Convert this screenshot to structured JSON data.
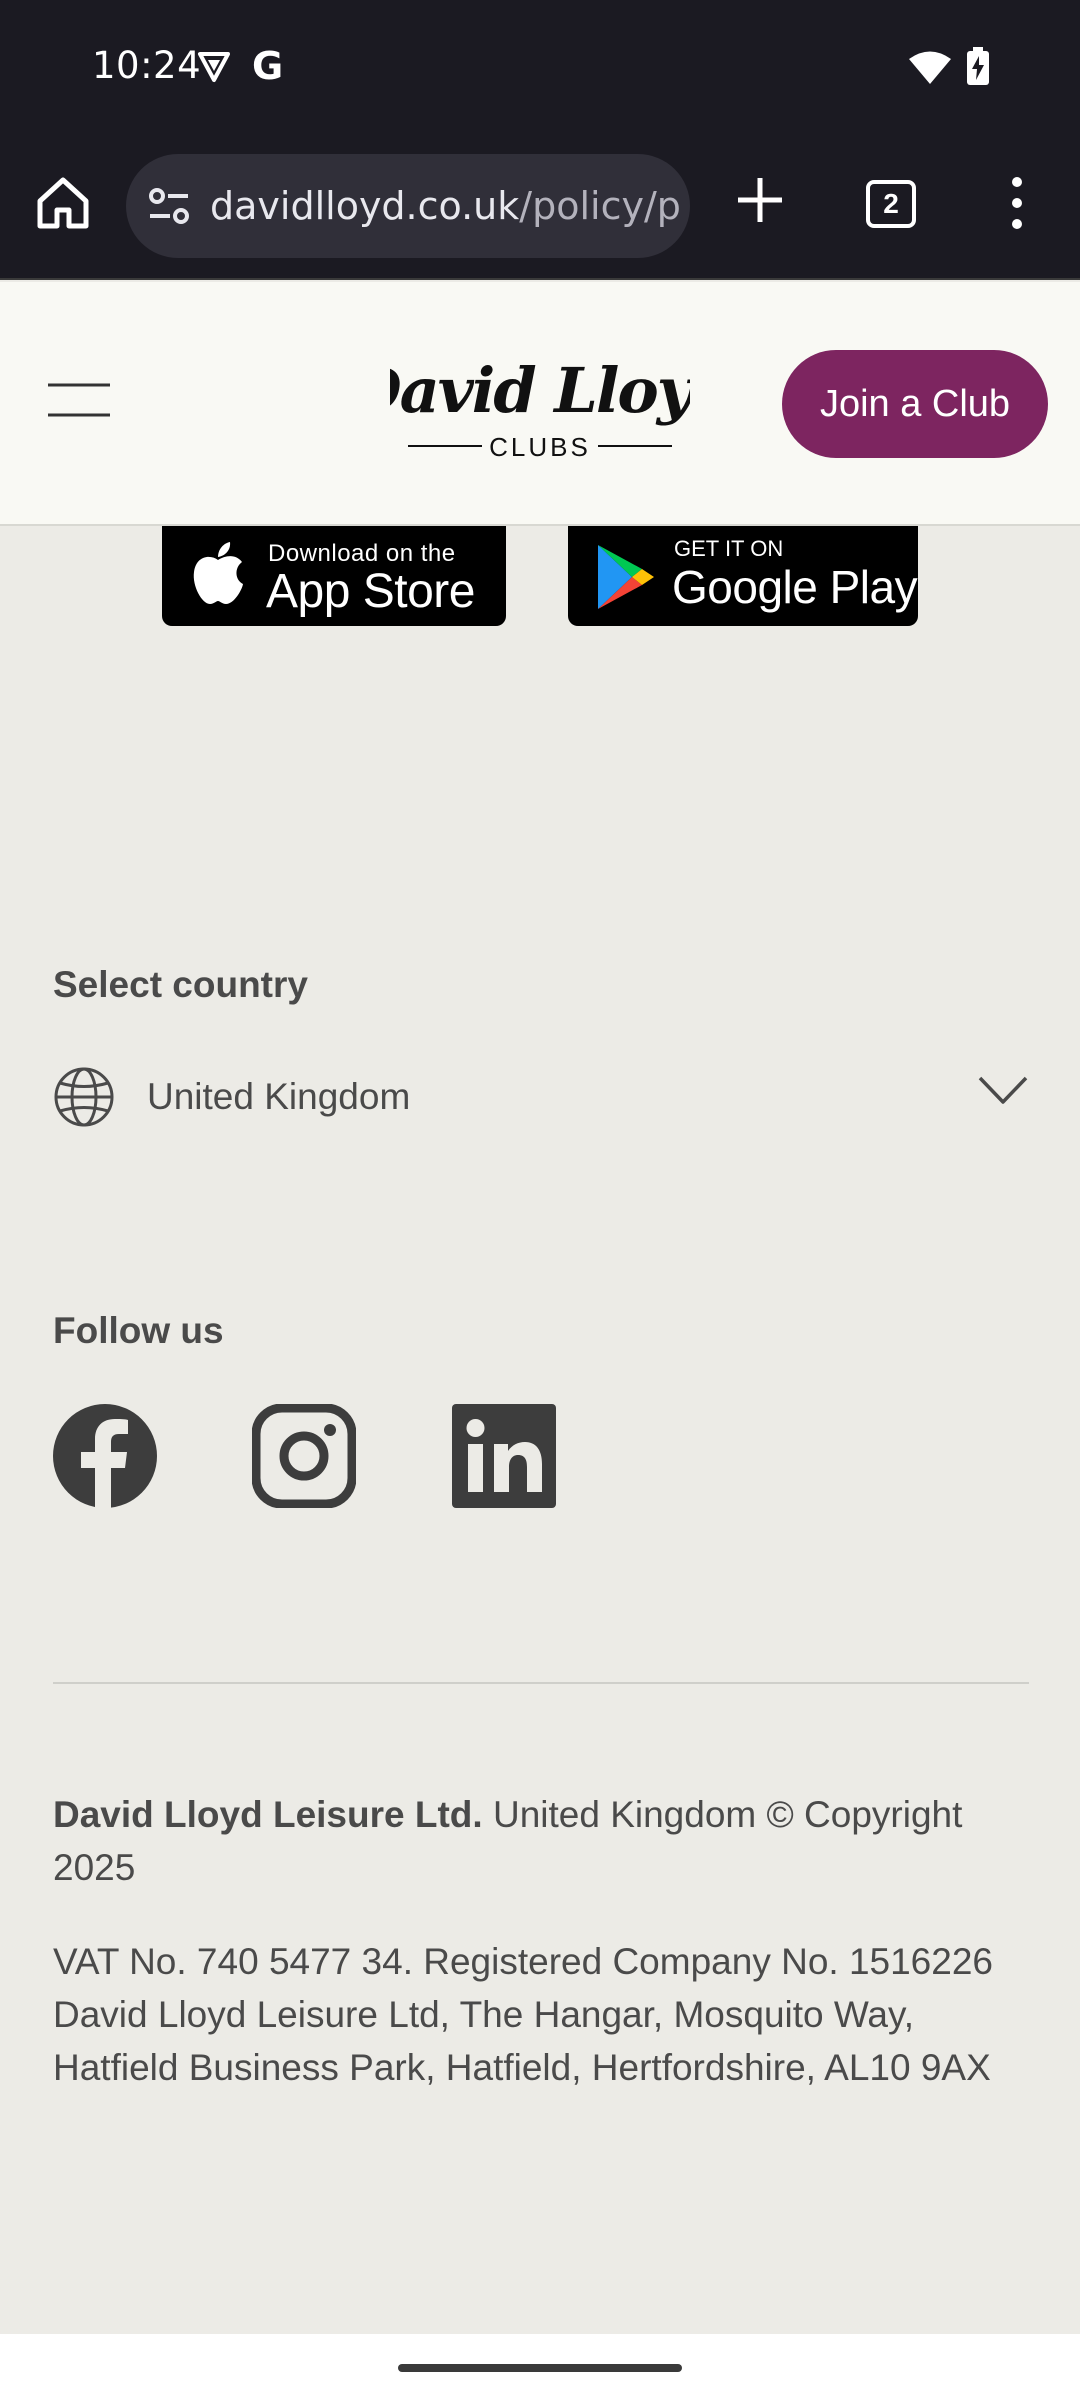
{
  "status_bar": {
    "time": "10:24",
    "g_label": "G"
  },
  "browser": {
    "url_domain": "davidlloyd.co.uk",
    "url_path": "/policy/p",
    "tab_count": "2"
  },
  "header": {
    "logo_text": "David Lloyd",
    "logo_subtext": "CLUBS",
    "join_label": "Join a Club",
    "accent_color": "#7d2560"
  },
  "app_badges": {
    "appstore_small": "Download on the",
    "appstore_big": "App Store",
    "google_small": "GET IT ON",
    "google_big": "Google Play"
  },
  "footer": {
    "select_country_heading": "Select country",
    "country_value": "United Kingdom",
    "follow_heading": "Follow us",
    "social_icons": [
      "facebook-icon",
      "instagram-icon",
      "linkedin-icon"
    ],
    "company_name": "David Lloyd Leisure Ltd.",
    "copyright": " United Kingdom © Copyright 2025",
    "registration": "VAT No. 740 5477 34. Registered Company No. 1516226 David Lloyd Leisure Ltd, The Hangar, Mosquito Way, Hatfield Business Park, Hatfield, Hertfordshire, AL10 9AX"
  }
}
